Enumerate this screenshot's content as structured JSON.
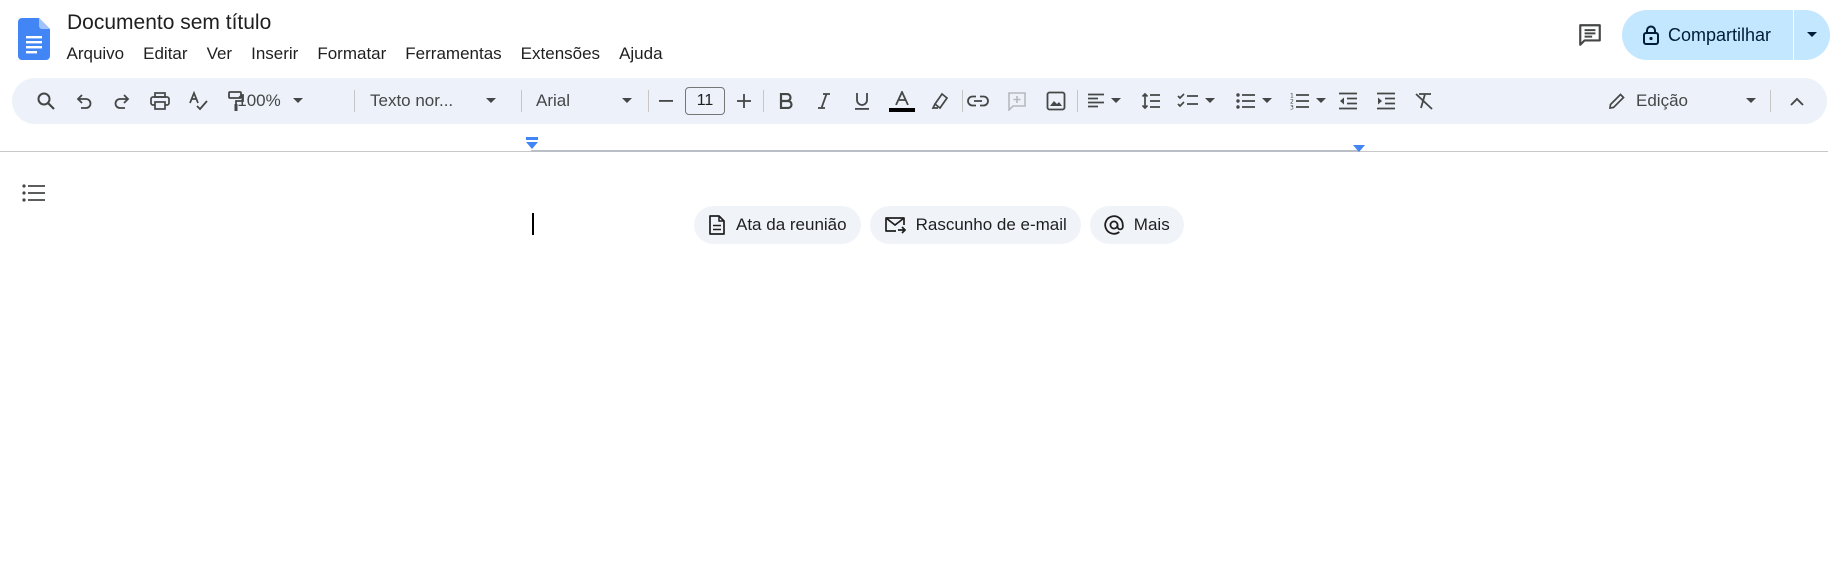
{
  "app": {
    "title": "Documento sem título",
    "icon": "google-docs-icon",
    "accent_color": "#1a73e8"
  },
  "menu": [
    "Arquivo",
    "Editar",
    "Ver",
    "Inserir",
    "Formatar",
    "Ferramentas",
    "Extensões",
    "Ajuda"
  ],
  "share": {
    "label": "Compartilhar",
    "icon": "lock-icon",
    "bg_color": "#c2e7ff"
  },
  "toolbar": {
    "zoom": "100%",
    "style": "Texto nor...",
    "font": "Arial",
    "font_size": "11",
    "mode": "Edição",
    "text_color": "#000000"
  },
  "chips": [
    {
      "label": "Ata da reunião",
      "icon": "document-icon"
    },
    {
      "label": "Rascunho de e-mail",
      "icon": "email-draft-icon"
    },
    {
      "label": "Mais",
      "icon": "at-sign-icon"
    }
  ]
}
